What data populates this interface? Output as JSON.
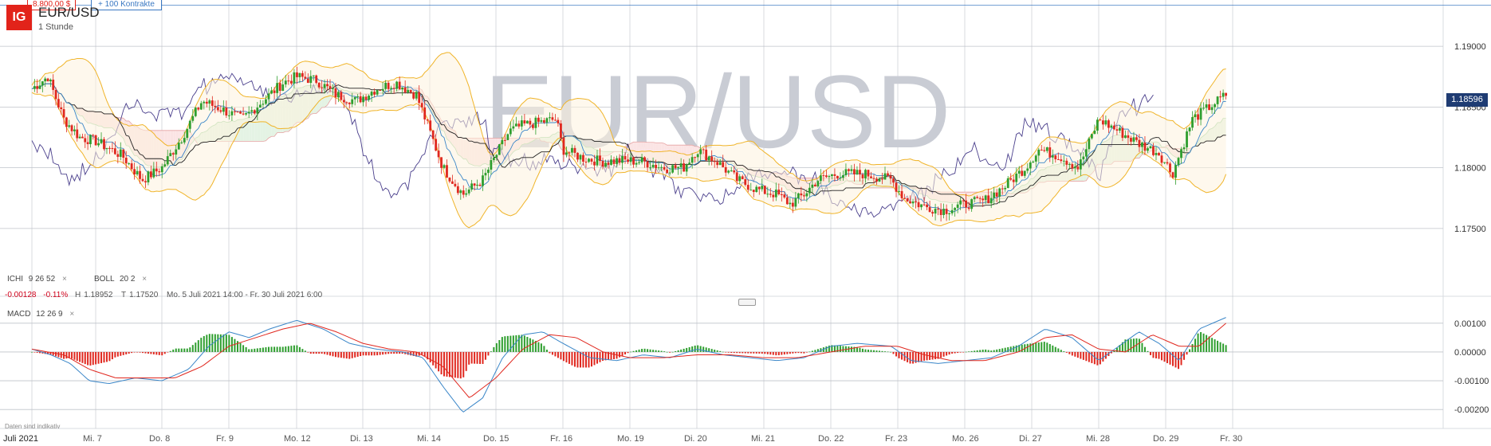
{
  "header": {
    "logo": "IG",
    "symbol": "EUR/USD",
    "interval": "1 Stunde",
    "watermark": "EUR/USD",
    "ticket_sell": "8.800,00 $",
    "ticket_qty": "+ 100 Kontrakte"
  },
  "indicators": {
    "ichi": {
      "name": "ICHI",
      "params": "9  26  52"
    },
    "boll": {
      "name": "BOLL",
      "params": "20  2"
    },
    "macd": {
      "name": "MACD",
      "params": "12  26  9"
    },
    "remove_glyph": "×"
  },
  "stats": {
    "change": "-0.00128",
    "change_pct": "-0.11%",
    "high_label": "H",
    "high": "1.18952",
    "low_label": "T",
    "low": "1.17520",
    "range": "Mo. 5 Juli 2021 14:00 - Fr. 30 Juli 2021 6:00"
  },
  "current_price": "1.18596",
  "footnote": "Daten sind indikativ",
  "colors": {
    "up": "#2e9e2e",
    "down": "#e0281f",
    "boll": "#f0b429",
    "cloud_up": "#e4f3e4",
    "cloud_down": "#fbe4e4",
    "ichi_line": "#4a3f8c",
    "kijun": "#222222",
    "tenkan": "#3a86c8",
    "macd": "#3a86c8",
    "signal": "#e0281f",
    "watermark": "#c9ccd4",
    "grid": "#bfc3ca",
    "badge": "#1f3c73",
    "logo": "#e2231a"
  },
  "chart_data": {
    "type": "candlestick",
    "symbol": "EUR/USD",
    "timeframe": "1 Stunde",
    "x_axis_labels": [
      "Juli 2021",
      "Mi. 7",
      "Do. 8",
      "Fr. 9",
      "Mo. 12",
      "Di. 13",
      "Mi. 14",
      "Do. 15",
      "Fr. 16",
      "Mo. 19",
      "Di. 20",
      "Mi. 21",
      "Do. 22",
      "Fr. 23",
      "Mo. 26",
      "Di. 27",
      "Mi. 28",
      "Do. 29",
      "Fr. 30"
    ],
    "price_axis": {
      "ticks": [
        "1.19000",
        "1.18500",
        "1.18000",
        "1.17500"
      ],
      "range": [
        1.1725,
        1.1925
      ]
    },
    "macd_axis": {
      "ticks": [
        "0.00100",
        "0.00000",
        "-0.00100",
        "-0.00200"
      ],
      "range": [
        -0.0023,
        0.0013
      ]
    },
    "price_path": [
      [
        0,
        1.1865
      ],
      [
        0.25,
        1.1875
      ],
      [
        0.5,
        1.184
      ],
      [
        0.75,
        1.1825
      ],
      [
        1.0,
        1.1822
      ],
      [
        1.4,
        1.181
      ],
      [
        1.7,
        1.179
      ],
      [
        2.0,
        1.18
      ],
      [
        2.3,
        1.1825
      ],
      [
        2.6,
        1.1855
      ],
      [
        2.9,
        1.1848
      ],
      [
        3.2,
        1.184
      ],
      [
        3.5,
        1.1855
      ],
      [
        3.8,
        1.187
      ],
      [
        4.0,
        1.1875
      ],
      [
        4.3,
        1.1872
      ],
      [
        4.6,
        1.186
      ],
      [
        4.9,
        1.1855
      ],
      [
        5.2,
        1.1865
      ],
      [
        5.5,
        1.187
      ],
      [
        5.8,
        1.186
      ],
      [
        6.0,
        1.183
      ],
      [
        6.2,
        1.18
      ],
      [
        6.5,
        1.1778
      ],
      [
        6.8,
        1.179
      ],
      [
        7.0,
        1.181
      ],
      [
        7.2,
        1.183
      ],
      [
        7.4,
        1.1835
      ],
      [
        7.7,
        1.1838
      ],
      [
        7.9,
        1.184
      ],
      [
        8.0,
        1.1815
      ],
      [
        8.3,
        1.1808
      ],
      [
        8.6,
        1.1805
      ],
      [
        8.9,
        1.1806
      ],
      [
        9.2,
        1.1805
      ],
      [
        9.5,
        1.18
      ],
      [
        9.8,
        1.18
      ],
      [
        10.0,
        1.1815
      ],
      [
        10.3,
        1.1805
      ],
      [
        10.6,
        1.179
      ],
      [
        10.9,
        1.1782
      ],
      [
        11.2,
        1.1778
      ],
      [
        11.4,
        1.177
      ],
      [
        11.6,
        1.1778
      ],
      [
        11.8,
        1.179
      ],
      [
        12.1,
        1.1795
      ],
      [
        12.5,
        1.1795
      ],
      [
        12.9,
        1.179
      ],
      [
        13.1,
        1.1775
      ],
      [
        13.4,
        1.1768
      ],
      [
        13.7,
        1.1765
      ],
      [
        14.0,
        1.177
      ],
      [
        14.3,
        1.1773
      ],
      [
        14.6,
        1.1785
      ],
      [
        14.9,
        1.18
      ],
      [
        15.1,
        1.1815
      ],
      [
        15.4,
        1.181
      ],
      [
        15.7,
        1.18
      ],
      [
        16.0,
        1.184
      ],
      [
        16.3,
        1.183
      ],
      [
        16.6,
        1.182
      ],
      [
        16.9,
        1.1812
      ],
      [
        17.1,
        1.1795
      ],
      [
        17.4,
        1.184
      ],
      [
        17.7,
        1.1852
      ],
      [
        17.9,
        1.186
      ]
    ],
    "macd_path": [
      [
        0,
        0.0001
      ],
      [
        0.3,
        -0.0001
      ],
      [
        0.6,
        -0.0004
      ],
      [
        0.9,
        -0.001
      ],
      [
        1.2,
        -0.0011
      ],
      [
        1.6,
        -0.0009
      ],
      [
        2.0,
        -0.001
      ],
      [
        2.4,
        -0.0006
      ],
      [
        2.7,
        0.0002
      ],
      [
        3.0,
        0.0007
      ],
      [
        3.3,
        0.0005
      ],
      [
        3.6,
        0.0008
      ],
      [
        4.0,
        0.0011
      ],
      [
        4.4,
        0.0008
      ],
      [
        4.8,
        0.0003
      ],
      [
        5.2,
        0.0001
      ],
      [
        5.6,
        0.0
      ],
      [
        5.9,
        -0.0002
      ],
      [
        6.2,
        -0.0012
      ],
      [
        6.5,
        -0.0021
      ],
      [
        6.8,
        -0.0016
      ],
      [
        7.1,
        -0.0002
      ],
      [
        7.4,
        0.0006
      ],
      [
        7.7,
        0.0007
      ],
      [
        8.0,
        0.0003
      ],
      [
        8.4,
        -0.0002
      ],
      [
        8.8,
        -0.0003
      ],
      [
        9.2,
        -0.0001
      ],
      [
        9.6,
        -0.0002
      ],
      [
        10.0,
        0.0001
      ],
      [
        10.4,
        -0.0001
      ],
      [
        10.8,
        -0.0002
      ],
      [
        11.2,
        -0.0003
      ],
      [
        11.6,
        -0.0002
      ],
      [
        12.0,
        0.0002
      ],
      [
        12.4,
        0.0003
      ],
      [
        12.9,
        0.0002
      ],
      [
        13.2,
        -0.0003
      ],
      [
        13.6,
        -0.0004
      ],
      [
        14.0,
        -0.0003
      ],
      [
        14.4,
        -0.0002
      ],
      [
        14.8,
        0.0002
      ],
      [
        15.2,
        0.0008
      ],
      [
        15.6,
        0.0005
      ],
      [
        16.0,
        -0.0003
      ],
      [
        16.3,
        0.0002
      ],
      [
        16.6,
        0.0007
      ],
      [
        16.9,
        0.0003
      ],
      [
        17.2,
        -0.0003
      ],
      [
        17.5,
        0.0008
      ],
      [
        17.8,
        0.0011
      ],
      [
        17.9,
        0.0012
      ]
    ],
    "signal_path": [
      [
        0,
        0.0001
      ],
      [
        0.5,
        -0.0001
      ],
      [
        0.9,
        -0.0006
      ],
      [
        1.3,
        -0.0009
      ],
      [
        1.8,
        -0.0009
      ],
      [
        2.2,
        -0.0009
      ],
      [
        2.6,
        -0.0005
      ],
      [
        3.0,
        0.0002
      ],
      [
        3.4,
        0.0005
      ],
      [
        3.8,
        0.0008
      ],
      [
        4.2,
        0.001
      ],
      [
        4.6,
        0.0007
      ],
      [
        5.0,
        0.0003
      ],
      [
        5.4,
        0.0001
      ],
      [
        5.8,
        -0.0
      ],
      [
        6.2,
        -0.0005
      ],
      [
        6.6,
        -0.0016
      ],
      [
        7.0,
        -0.0009
      ],
      [
        7.4,
        0.0001
      ],
      [
        7.8,
        0.0006
      ],
      [
        8.2,
        0.0005
      ],
      [
        8.6,
        0.0
      ],
      [
        9.0,
        -0.0002
      ],
      [
        9.5,
        -0.0002
      ],
      [
        10.0,
        -0.0001
      ],
      [
        10.5,
        -0.0001
      ],
      [
        11.0,
        -0.0002
      ],
      [
        11.5,
        -0.0002
      ],
      [
        12.0,
        0.0
      ],
      [
        12.5,
        0.0002
      ],
      [
        13.0,
        0.0002
      ],
      [
        13.4,
        -0.0001
      ],
      [
        13.8,
        -0.0003
      ],
      [
        14.3,
        -0.0003
      ],
      [
        14.8,
        -0.0
      ],
      [
        15.2,
        0.0005
      ],
      [
        15.6,
        0.0006
      ],
      [
        16.0,
        0.0001
      ],
      [
        16.4,
        -0.0
      ],
      [
        16.8,
        0.0006
      ],
      [
        17.2,
        0.0002
      ],
      [
        17.5,
        0.0002
      ],
      [
        17.9,
        0.001
      ]
    ]
  }
}
